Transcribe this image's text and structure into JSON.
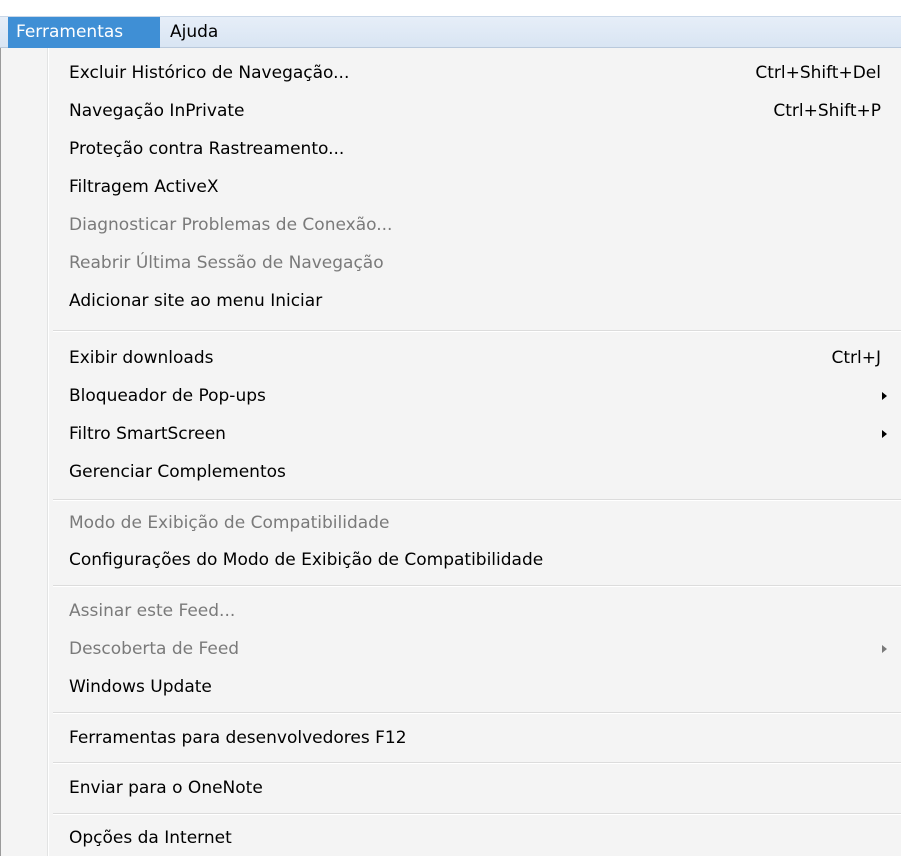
{
  "menubar": {
    "items": [
      {
        "label": "Ferramentas"
      },
      {
        "label": "Ajuda"
      }
    ],
    "active_color": "#3f8fd5"
  },
  "tools_menu": {
    "items": [
      {
        "label": "Excluir Histórico de Navegação...",
        "shortcut": "Ctrl+Shift+Del"
      },
      {
        "label": "Navegação InPrivate",
        "shortcut": "Ctrl+Shift+P"
      },
      {
        "label": "Proteção contra Rastreamento..."
      },
      {
        "label": "Filtragem ActiveX"
      },
      {
        "label": "Diagnosticar Problemas de Conexão...",
        "disabled": true
      },
      {
        "label": "Reabrir Última Sessão de Navegação",
        "disabled": true
      },
      {
        "label": "Adicionar site ao menu Iniciar"
      },
      {
        "label": "Exibir downloads",
        "shortcut": "Ctrl+J"
      },
      {
        "label": "Bloqueador de Pop-ups",
        "submenu": true
      },
      {
        "label": "Filtro SmartScreen",
        "submenu": true
      },
      {
        "label": "Gerenciar Complementos"
      },
      {
        "label": "Modo de Exibição de Compatibilidade",
        "disabled": true
      },
      {
        "label": "Configurações do Modo de Exibição de Compatibilidade"
      },
      {
        "label": "Assinar este Feed...",
        "disabled": true
      },
      {
        "label": "Descoberta de Feed",
        "disabled": true,
        "submenu": true
      },
      {
        "label": "Windows Update"
      },
      {
        "label": "Ferramentas para desenvolvedores F12"
      },
      {
        "label": "Enviar para o OneNote"
      },
      {
        "label": "Opções da Internet"
      }
    ]
  }
}
